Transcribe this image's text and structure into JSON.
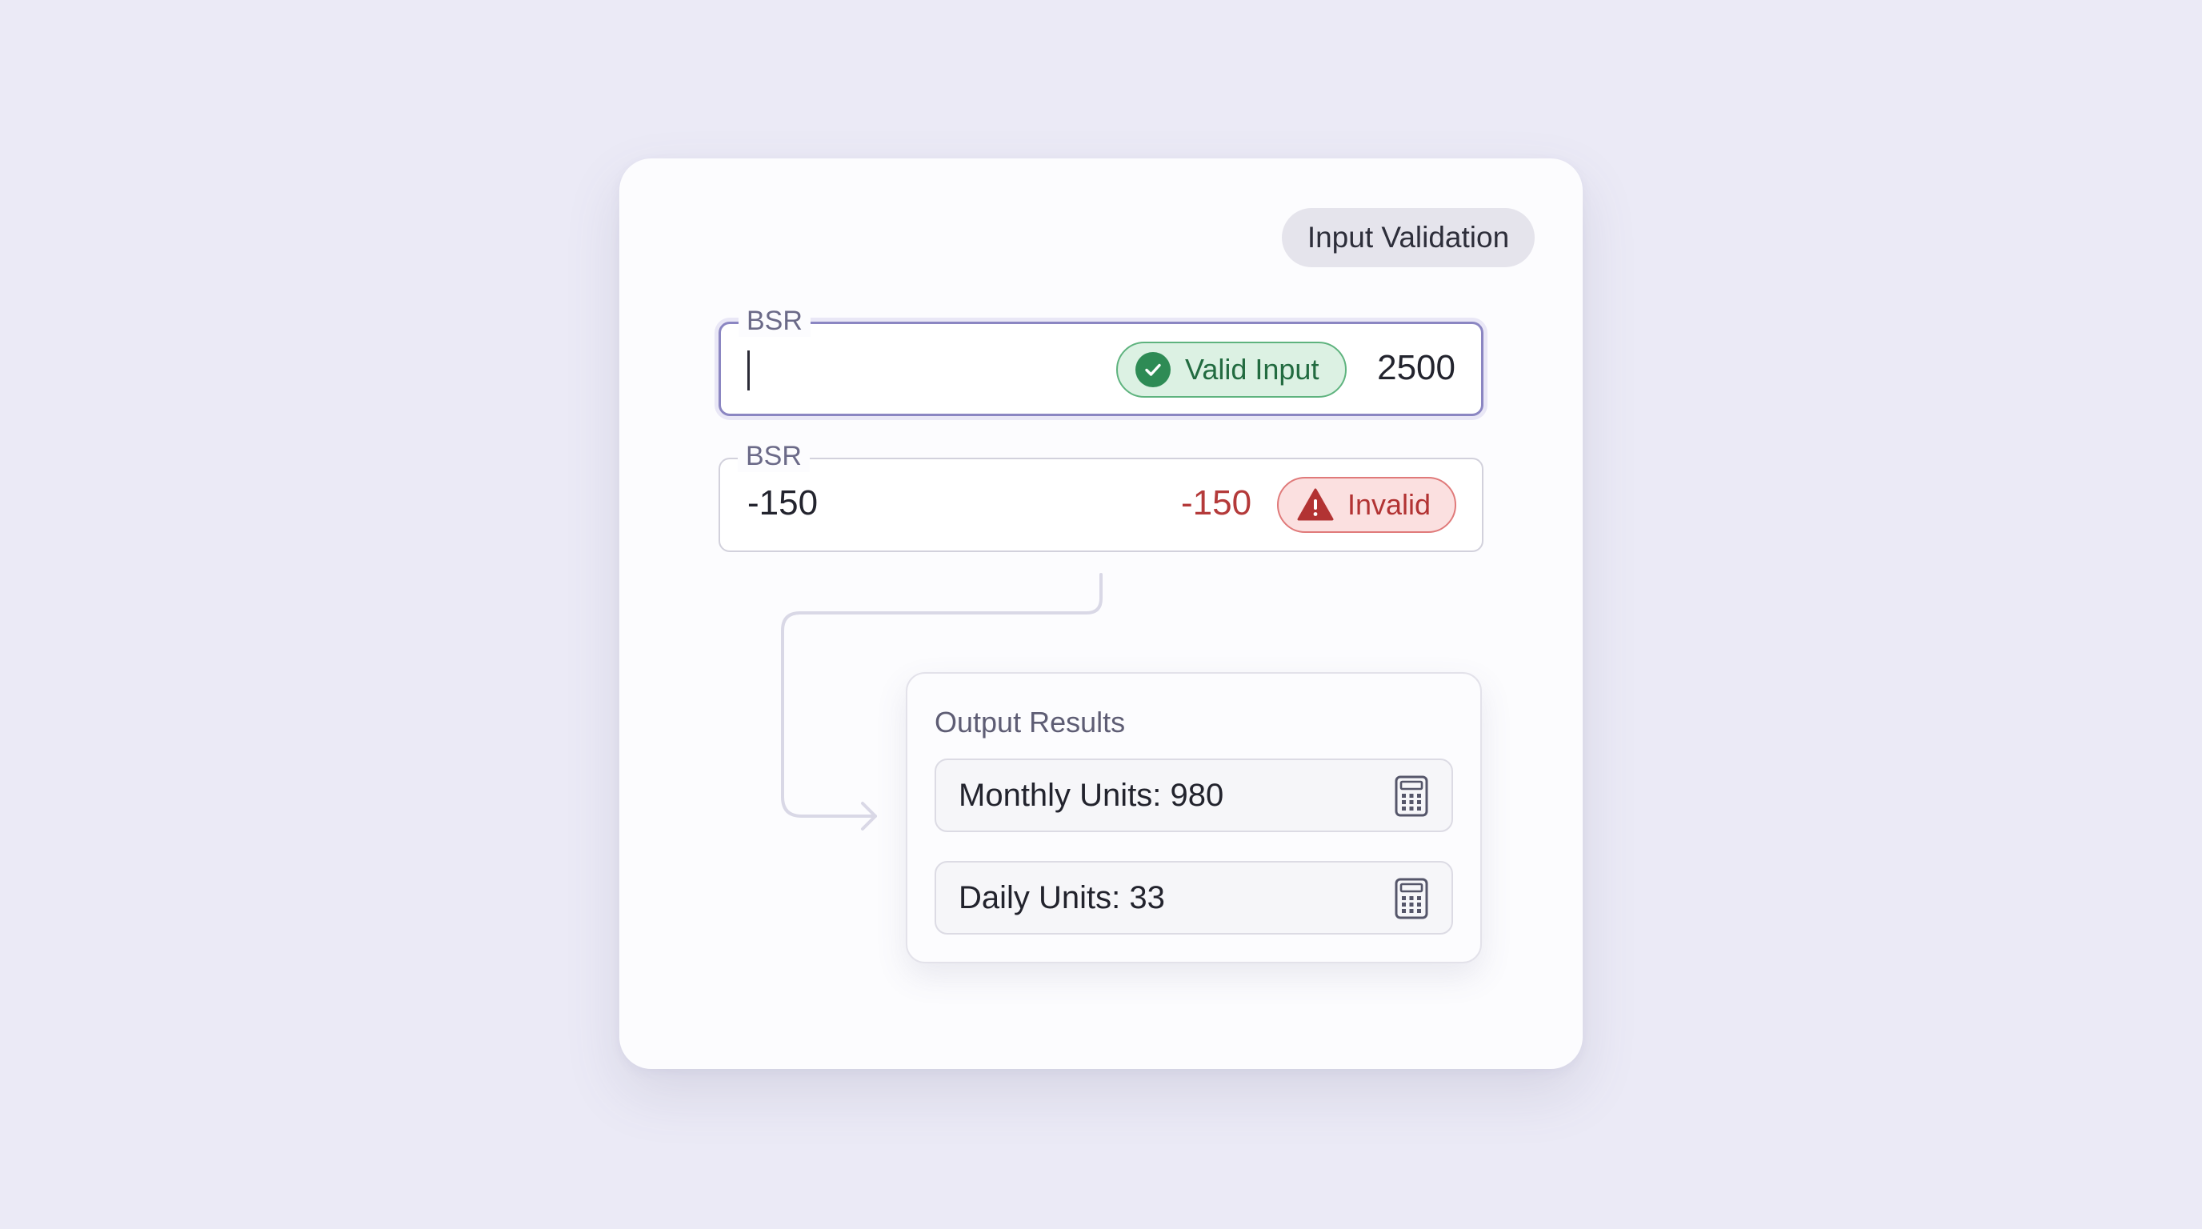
{
  "badge": {
    "label": "Input Validation"
  },
  "fields": [
    {
      "label": "BSR",
      "input_value": "",
      "status_label": "Valid Input",
      "display_value": "2500",
      "status": "valid"
    },
    {
      "label": "BSR",
      "input_value": "-150",
      "status_label": "Invalid",
      "display_value": "-150",
      "status": "invalid"
    }
  ],
  "results": {
    "title": "Output Results",
    "rows": [
      {
        "label": "Monthly Units: 980",
        "icon": "calculator-icon"
      },
      {
        "label": "Daily Units: 33",
        "icon": "calculator-icon"
      }
    ]
  },
  "colors": {
    "valid": "#2e8b55",
    "invalid": "#b43a3a",
    "focus_border": "#8b86c2",
    "background": "#ebeaf6"
  }
}
